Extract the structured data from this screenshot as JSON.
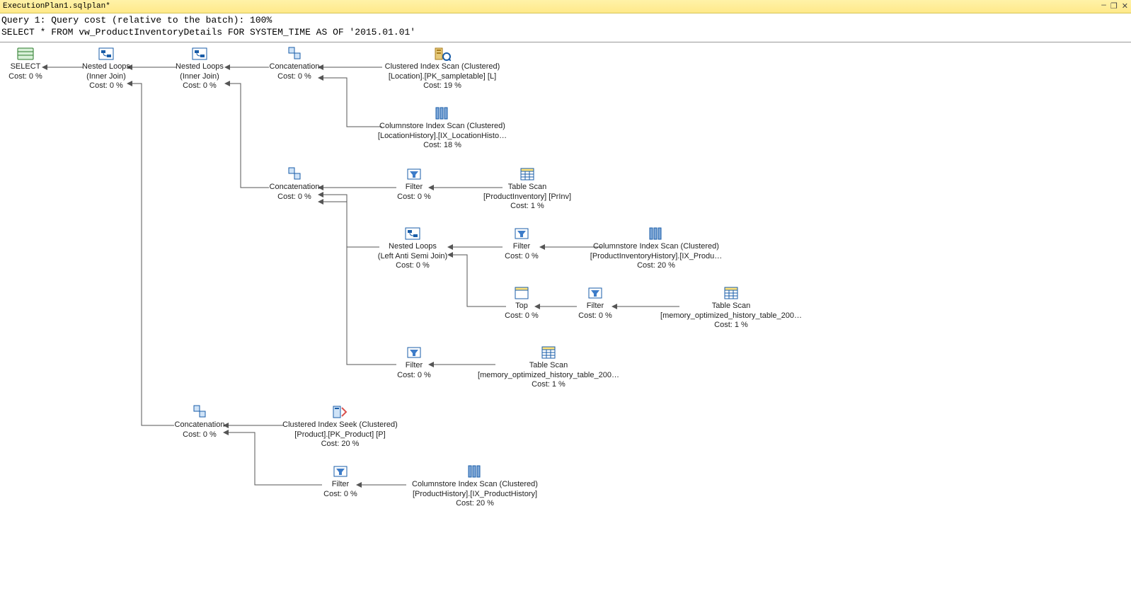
{
  "tab": {
    "title": "ExecutionPlan1.sqlplan*"
  },
  "window_controls": {
    "min": "—",
    "restore": "❐",
    "close": "✕"
  },
  "header": {
    "line1": "Query 1: Query cost (relative to the batch): 100%",
    "line2": "SELECT * FROM vw_ProductInventoryDetails FOR SYSTEM_TIME AS OF '2015.01.01'"
  },
  "nodes": {
    "select": {
      "l1": "SELECT",
      "l2": "",
      "l3": "Cost: 0 %"
    },
    "nl1": {
      "l1": "Nested Loops",
      "l2": "(Inner Join)",
      "l3": "Cost: 0 %"
    },
    "nl2": {
      "l1": "Nested Loops",
      "l2": "(Inner Join)",
      "l3": "Cost: 0 %"
    },
    "concat1": {
      "l1": "Concatenation",
      "l2": "Cost: 0 %",
      "l3": ""
    },
    "cis_loc": {
      "l1": "Clustered Index Scan (Clustered)",
      "l2": "[Location].[PK_sampletable] [L]",
      "l3": "Cost: 19 %"
    },
    "css_loc": {
      "l1": "Columnstore Index Scan (Clustered)",
      "l2": "[LocationHistory].[IX_LocationHisto…",
      "l3": "Cost: 18 %"
    },
    "concat2": {
      "l1": "Concatenation",
      "l2": "Cost: 0 %",
      "l3": ""
    },
    "filter1": {
      "l1": "Filter",
      "l2": "Cost: 0 %",
      "l3": ""
    },
    "ts_prinv": {
      "l1": "Table Scan",
      "l2": "[ProductInventory] [PrInv]",
      "l3": "Cost: 1 %"
    },
    "nl3": {
      "l1": "Nested Loops",
      "l2": "(Left Anti Semi Join)",
      "l3": "Cost: 0 %"
    },
    "filter2": {
      "l1": "Filter",
      "l2": "Cost: 0 %",
      "l3": ""
    },
    "css_prinv": {
      "l1": "Columnstore Index Scan (Clustered)",
      "l2": "[ProductInventoryHistory].[IX_Produ…",
      "l3": "Cost: 20 %"
    },
    "top": {
      "l1": "Top",
      "l2": "Cost: 0 %",
      "l3": ""
    },
    "filter3": {
      "l1": "Filter",
      "l2": "Cost: 0 %",
      "l3": ""
    },
    "ts_hist1": {
      "l1": "Table Scan",
      "l2": "[memory_optimized_history_table_200…",
      "l3": "Cost: 1 %"
    },
    "filter4": {
      "l1": "Filter",
      "l2": "Cost: 0 %",
      "l3": ""
    },
    "ts_hist2": {
      "l1": "Table Scan",
      "l2": "[memory_optimized_history_table_200…",
      "l3": "Cost: 1 %"
    },
    "concat3": {
      "l1": "Concatenation",
      "l2": "Cost: 0 %",
      "l3": ""
    },
    "ciseek": {
      "l1": "Clustered Index Seek (Clustered)",
      "l2": "[Product].[PK_Product] [P]",
      "l3": "Cost: 20 %"
    },
    "filter5": {
      "l1": "Filter",
      "l2": "Cost: 0 %",
      "l3": ""
    },
    "css_prod": {
      "l1": "Columnstore Index Scan (Clustered)",
      "l2": "[ProductHistory].[IX_ProductHistory]",
      "l3": "Cost: 20 %"
    }
  }
}
